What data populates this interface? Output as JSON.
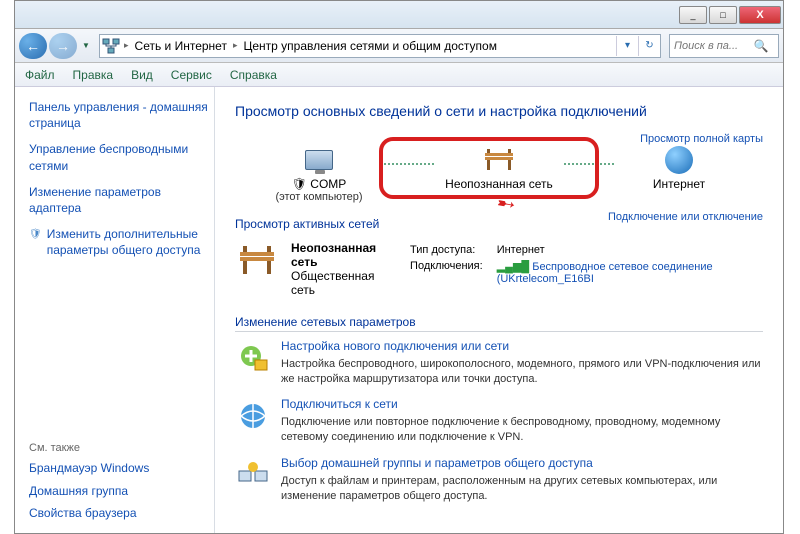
{
  "window": {
    "min": "_",
    "max": "□",
    "close": "X"
  },
  "nav": {
    "back": "←",
    "fwd": "→"
  },
  "breadcrumb": {
    "level1": "Сеть и Интернет",
    "level2": "Центр управления сетями и общим доступом"
  },
  "search": {
    "placeholder": "Поиск в па..."
  },
  "menu": {
    "file": "Файл",
    "edit": "Правка",
    "view": "Вид",
    "tools": "Сервис",
    "help": "Справка"
  },
  "sidebar": {
    "home": "Панель управления - домашняя страница",
    "wireless": "Управление беспроводными сетями",
    "adapter": "Изменение параметров адаптера",
    "sharing": "Изменить дополнительные параметры общего доступа",
    "see_also": "См. также",
    "firewall": "Брандмауэр Windows",
    "homegroup": "Домашняя группа",
    "browser": "Свойства браузера"
  },
  "main": {
    "heading": "Просмотр основных сведений о сети и настройка подключений",
    "fullmap": "Просмотр полной карты",
    "node_comp": "COMP",
    "node_comp_sub": "(этот компьютер)",
    "node_unknown": "Неопознанная сеть",
    "node_internet": "Интернет",
    "active_head": "Просмотр активных сетей",
    "conn_toggle": "Подключение или отключение",
    "active_title": "Неопознанная сеть",
    "active_sub": "Общественная сеть",
    "access_type_label": "Тип доступа:",
    "access_type_val": "Интернет",
    "connections_label": "Подключения:",
    "connection_name": "Беспроводное сетевое соединение (UKrtelecom_E16BI",
    "params_head": "Изменение сетевых параметров",
    "task1_title": "Настройка нового подключения или сети",
    "task1_desc": "Настройка беспроводного, широкополосного, модемного, прямого или VPN-подключения или же настройка маршрутизатора или точки доступа.",
    "task2_title": "Подключиться к сети",
    "task2_desc": "Подключение или повторное подключение к беспроводному, проводному, модемному сетевому соединению или подключение к VPN.",
    "task3_title": "Выбор домашней группы и параметров общего доступа",
    "task3_desc": "Доступ к файлам и принтерам, расположенным на других сетевых компьютерах, или изменение параметров общего доступа."
  }
}
